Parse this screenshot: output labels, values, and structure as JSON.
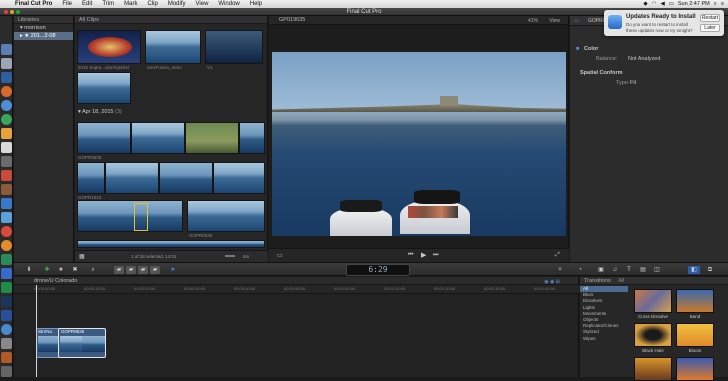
{
  "menubar": {
    "app_name": "Final Cut Pro",
    "menus": [
      "File",
      "Edit",
      "Trim",
      "Mark",
      "Clip",
      "Modify",
      "View",
      "Window",
      "Help"
    ],
    "clock": "Sun 2:47 PM"
  },
  "window": {
    "title": "Final Cut Pro"
  },
  "notification": {
    "title": "Updates Ready to Install",
    "body_line1": "Do you want to restart to install",
    "body_line2": "these updates now or try tonight?",
    "restart_label": "Restart",
    "later_label": "Later"
  },
  "libraries": {
    "header": "Libraries",
    "items": [
      {
        "label": "morrison"
      },
      {
        "label": "201...2-08"
      }
    ]
  },
  "browser": {
    "header": "All Clips",
    "top_captions": [
      "2015 Supra...olor/mp4/rel",
      "SerrFusion_remo",
      "V1"
    ],
    "date_label": "Apr 18, 2015",
    "date_count": "(3)",
    "clip_captions": [
      "GOPR0635",
      "GOPR1010",
      "GOPR0635"
    ],
    "status": "1 of 28 selected, 14:01",
    "zoom_label": "5m"
  },
  "viewer": {
    "clip_name": "GP019635",
    "zoom": "41%",
    "view_label": "View"
  },
  "inspector": {
    "clip_name": "GOPR0",
    "color_label": "Color",
    "balance_label": "Balance:",
    "balance_value": "Not Analyzed",
    "spatial_label": "Spatial Conform",
    "type_label": "Type:",
    "type_value": "Fit"
  },
  "toolbar": {
    "timecode": "6:29"
  },
  "timeline": {
    "project_name": "drone/U Colorado",
    "ruler_ticks": [
      "00:00:00:00",
      "00:00:10:00",
      "00:00:20:00",
      "00:00:30:00",
      "00:00:40:00",
      "00:00:50:00",
      "00:01:00:00",
      "00:01:10:00",
      "00:01:20:00",
      "00:01:30:00",
      "00:01:40:00"
    ],
    "clips": [
      "StrnNo",
      "GOPR9635"
    ]
  },
  "transitions": {
    "header": "Transitions",
    "filter_label": "All",
    "categories": [
      "All",
      "Blurs",
      "Dissolves",
      "Lights",
      "Movements",
      "Objects",
      "Replicator/Clones",
      "Stylized",
      "Wipes"
    ],
    "items": [
      {
        "label": "Cross Dissolve"
      },
      {
        "label": "Band"
      },
      {
        "label": "Black Hole"
      },
      {
        "label": "Bloom"
      }
    ]
  }
}
